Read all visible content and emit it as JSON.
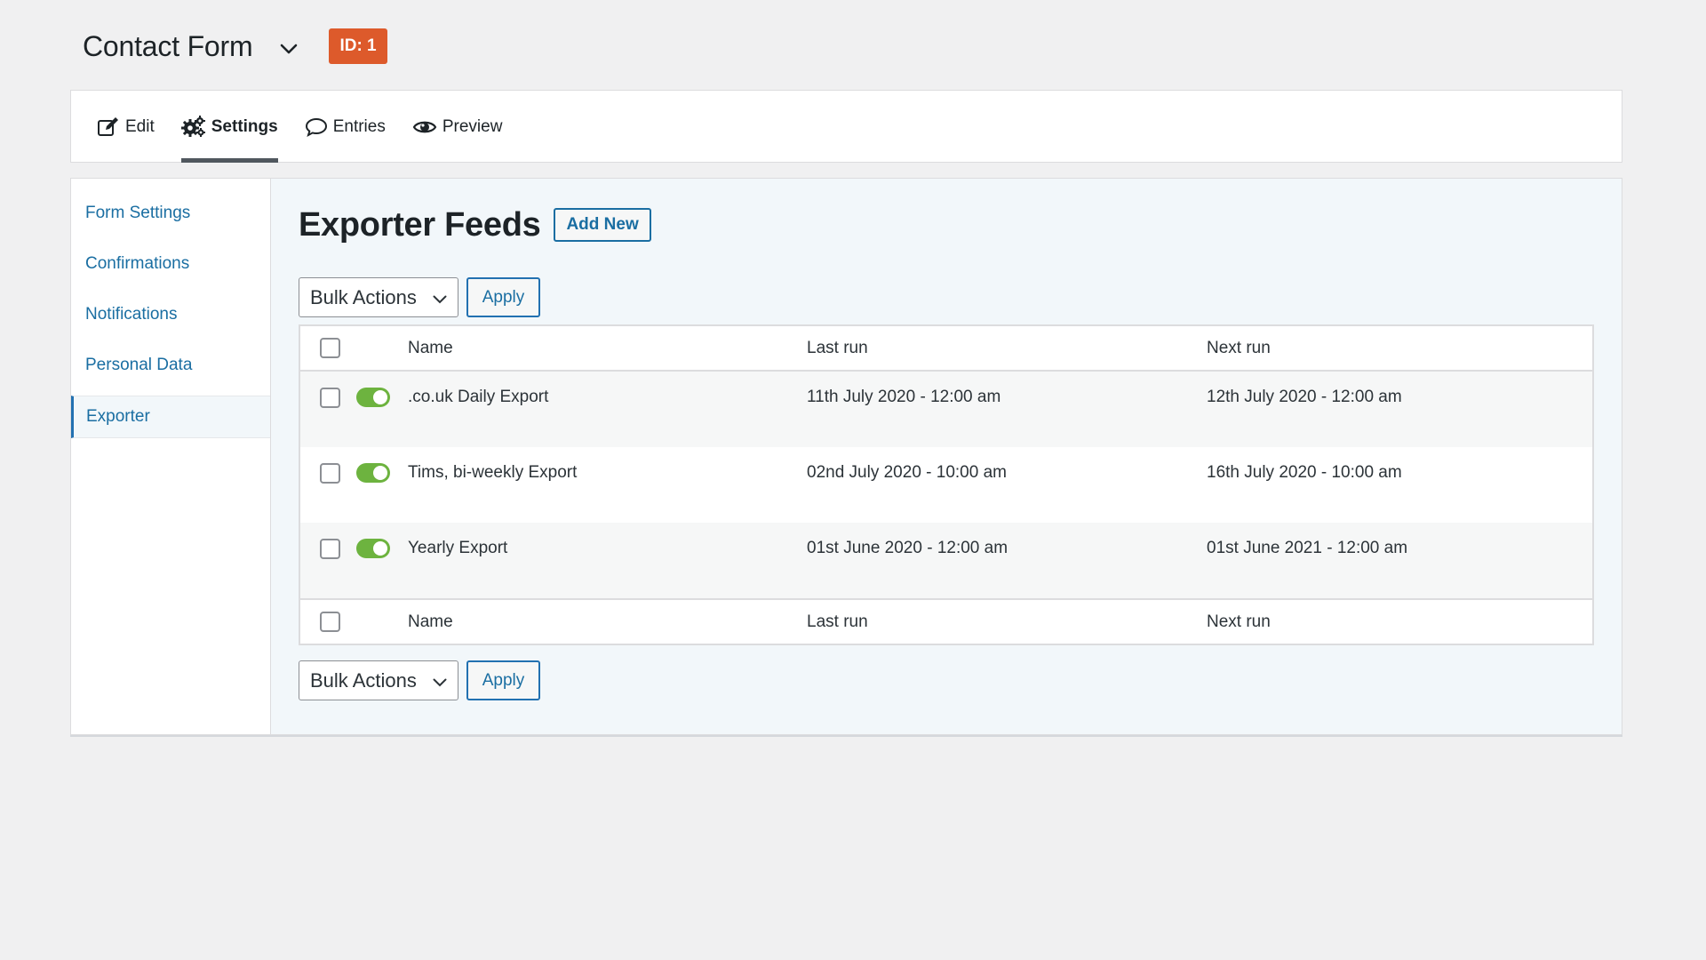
{
  "header": {
    "form_title": "Contact Form",
    "id_badge": "ID: 1"
  },
  "tabs": [
    {
      "label": "Edit",
      "icon": "edit-icon",
      "active": false
    },
    {
      "label": "Settings",
      "icon": "gear-icon",
      "active": true
    },
    {
      "label": "Entries",
      "icon": "speech-bubble-icon",
      "active": false
    },
    {
      "label": "Preview",
      "icon": "eye-icon",
      "active": false
    }
  ],
  "sidebar": {
    "items": [
      {
        "label": "Form Settings",
        "active": false
      },
      {
        "label": "Confirmations",
        "active": false
      },
      {
        "label": "Notifications",
        "active": false
      },
      {
        "label": "Personal Data",
        "active": false
      },
      {
        "label": "Exporter",
        "active": true
      }
    ]
  },
  "main": {
    "title": "Exporter Feeds",
    "add_new_label": "Add New",
    "bulk_actions_label": "Bulk Actions",
    "apply_label": "Apply"
  },
  "table": {
    "columns": {
      "name": "Name",
      "last_run": "Last run",
      "next_run": "Next run"
    },
    "rows": [
      {
        "name": ".co.uk Daily Export",
        "last_run": "11th July 2020 - 12:00 am",
        "next_run": "12th July 2020 - 12:00 am",
        "enabled": true
      },
      {
        "name": "Tims, bi-weekly Export",
        "last_run": "02nd July 2020 - 10:00 am",
        "next_run": "16th July 2020 - 10:00 am",
        "enabled": true
      },
      {
        "name": "Yearly Export",
        "last_run": "01st June 2020 - 12:00 am",
        "next_run": "01st June 2021 - 12:00 am",
        "enabled": true
      }
    ]
  },
  "colors": {
    "accent": "#2271b1",
    "link": "#1a6ea2",
    "badge": "#dd5a2b",
    "toggle_on": "#6db33f"
  }
}
